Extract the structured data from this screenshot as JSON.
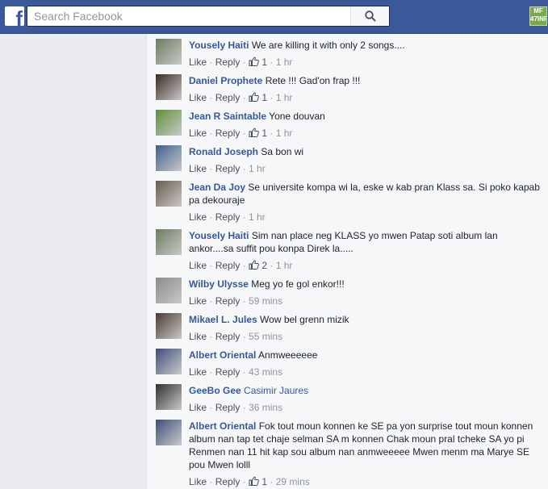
{
  "header": {
    "logo": "f",
    "search_placeholder": "Search Facebook",
    "badge_text": "MF 47INF"
  },
  "actions": {
    "like": "Like",
    "reply": "Reply",
    "sep": "·"
  },
  "colors": {
    "topbar": "#3b5998",
    "author": "#365899",
    "meta": "#90949c"
  },
  "comments": [
    {
      "author": "Yousely Haiti",
      "text": "We are killing it with only 2 songs....",
      "likes": "1",
      "time": "1 hr",
      "avatar_color": "#6b7d5e"
    },
    {
      "author": "Daniel Prophete",
      "text": "Rete !!! Gad'on frap !!!",
      "likes": "1",
      "time": "1 hr",
      "avatar_color": "#3a2a22"
    },
    {
      "author": "Jean R Saintable",
      "text": "Yone douvan",
      "likes": "1",
      "time": "1 hr",
      "avatar_color": "#5f8f3a"
    },
    {
      "author": "Ronald Joseph",
      "text": "Sa bon wi",
      "likes": "",
      "time": "1 hr",
      "avatar_color": "#3d5f8a"
    },
    {
      "author": "Jean Da Joy",
      "text": "Se universite kompa wi la, eske w kab pran Klass sa. Si poko kapab pa dekouraje",
      "likes": "",
      "time": "1 hr",
      "avatar_color": "#6a5a4a"
    },
    {
      "author": "Yousely Haiti",
      "text": "Sim nan place neg KLASS yo mwen Patap soti album lan ankor....sa suffit pou konpa Direk la.....",
      "likes": "2",
      "time": "1 hr",
      "avatar_color": "#6b7d5e"
    },
    {
      "author": "Wilby Ulysse",
      "text": "Meg yo fe gol enkor!!!",
      "likes": "",
      "time": "59 mins",
      "avatar_color": "#8a8a8a"
    },
    {
      "author": "Mikael L. Jules",
      "text": "Wow bel grenn mizik",
      "likes": "",
      "time": "55 mins",
      "avatar_color": "#4a3a30"
    },
    {
      "author": "Albert Oriental",
      "text": "Anmweeeeee",
      "likes": "",
      "time": "43 mins",
      "avatar_color": "#3e4f7a"
    },
    {
      "author": "GeeBo Gee",
      "author_tag": "Casimir Jaures",
      "text": "",
      "likes": "",
      "time": "36 mins",
      "avatar_color": "#2f2f2f"
    },
    {
      "author": "Albert Oriental",
      "text": "Fok tout moun konnen ke SE pa yon surprise tout moun konnen album nan tap tet chaje selman SA m konnen Chak moun pral tcheke SA yo pi Renmen nan 11 hit kap sou album nan anmweeeee Mwen menm ma Marye SE pou Mwen lolll",
      "likes": "1",
      "time": "29 mins",
      "avatar_color": "#3e4f7a"
    }
  ]
}
